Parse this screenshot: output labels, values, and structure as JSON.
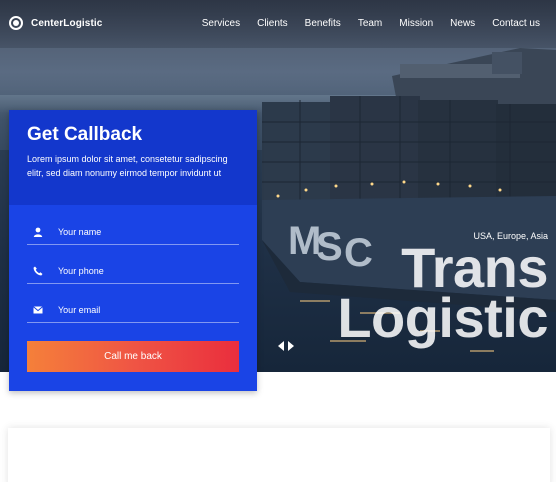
{
  "navbar": {
    "brand": "CenterLogistic",
    "items": [
      {
        "label": "Services"
      },
      {
        "label": "Clients"
      },
      {
        "label": "Benefits"
      },
      {
        "label": "Team"
      },
      {
        "label": "Mission"
      },
      {
        "label": "News"
      },
      {
        "label": "Contact us"
      }
    ]
  },
  "hero": {
    "tag": "USA, Europe, Asia",
    "title_line1": "Trans",
    "title_line2": "Logistic",
    "ship_hull_text": "MSC"
  },
  "callback": {
    "title": "Get Callback",
    "description": "Lorem ipsum dolor sit amet, consetetur sadipscing elitr, sed diam nonumy eirmod tempor invidunt ut",
    "fields": {
      "name_placeholder": "Your name",
      "phone_placeholder": "Your phone",
      "email_placeholder": "Your email"
    },
    "button_label": "Call me back"
  },
  "colors": {
    "card_blue": "#1a44e6",
    "card_head_blue": "#1337cc",
    "cta_start": "#f5803a",
    "cta_end": "#ea2e3d"
  },
  "icons": {
    "logo": "target-icon",
    "name": "person-icon",
    "phone": "phone-icon",
    "email": "envelope-icon",
    "prev": "chevron-left-icon",
    "next": "chevron-right-icon"
  }
}
